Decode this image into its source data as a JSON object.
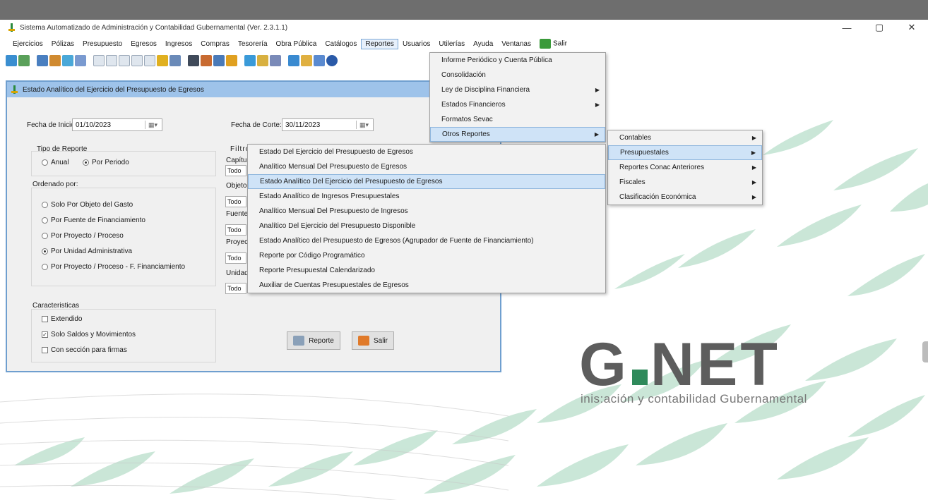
{
  "window": {
    "title": "Sistema Automatizado de Administración y Contabilidad Gubernamental (Ver. 2.3.1.1)",
    "controls": [
      "—",
      "▢",
      "✕"
    ]
  },
  "menubar": {
    "items": [
      "Ejercicios",
      "Pólizas",
      "Presupuesto",
      "Egresos",
      "Ingresos",
      "Compras",
      "Tesorería",
      "Obra Pública",
      "Catálogos",
      "Reportes",
      "Usuarios",
      "Utilerías",
      "Ayuda",
      "Ventanas"
    ],
    "active": "Reportes",
    "salir_label": "Salir"
  },
  "background": {
    "logo_text_left": "G",
    "logo_text_right": "NET",
    "logo_subtitle": "inis:ación y contabilidad Gubernamental",
    "accent": "#2f8a5b"
  },
  "dialog": {
    "title": "Estado Analítico del Ejercicio del Presupuesto de Egresos",
    "fecha_inicio_label": "Fecha de Inicio:",
    "fecha_inicio_value": "01/10/2023",
    "fecha_corte_label": "Fecha de Corte:",
    "fecha_corte_value": "30/11/2023",
    "tipo_reporte_label": "Tipo de Reporte",
    "tipo_anual": "Anual",
    "tipo_periodo": "Por Periodo",
    "filtros_label": "Filtros",
    "ordenado_label": "Ordenado por:",
    "ordenado_options": [
      "Solo Por Objeto del Gasto",
      "Por Fuente de Financiamiento",
      "Por Proyecto / Proceso",
      "Por Unidad Administrativa",
      "Por Proyecto / Proceso  -  F. Financiamiento"
    ],
    "ordenado_selected_index": 3,
    "caracteristicas_label": "Caracteristicas",
    "caracteristicas": [
      {
        "label": "Extendido",
        "checked": false
      },
      {
        "label": "Solo Saldos y Movimientos",
        "checked": true
      },
      {
        "label": "Con sección para firmas",
        "checked": false
      }
    ],
    "filter_fields": [
      {
        "label": "Capítu",
        "value": "Todo"
      },
      {
        "label": "Objeto",
        "value": "Todo"
      },
      {
        "label": "Fuente",
        "value": "Todo"
      },
      {
        "label": "Proyec",
        "value": "Todo"
      },
      {
        "label": "Unidad",
        "value": "Todo"
      }
    ],
    "reporte_button": "Reporte",
    "salir_button": "Salir"
  },
  "reportes_menu": {
    "items": [
      {
        "label": "Informe Periódico y Cuenta Pública",
        "submenu": false
      },
      {
        "label": "Consolidación",
        "submenu": false
      },
      {
        "label": "Ley de Disciplina Financiera",
        "submenu": true
      },
      {
        "label": "Estados Financieros",
        "submenu": true
      },
      {
        "label": "Formatos Sevac",
        "submenu": false
      },
      {
        "label": "Otros Reportes",
        "submenu": true
      }
    ],
    "selected_index": 5
  },
  "otros_menu": {
    "items": [
      {
        "label": "Contables",
        "submenu": true
      },
      {
        "label": "Presupuestales",
        "submenu": true
      },
      {
        "label": "Reportes Conac Anteriores",
        "submenu": true
      },
      {
        "label": "Fiscales",
        "submenu": true
      },
      {
        "label": "Clasificación Económica",
        "submenu": true
      }
    ],
    "selected_index": 1
  },
  "presupuestales_menu": {
    "items": [
      "Estado Del Ejercicio del Presupuesto de Egresos",
      "Analítico Mensual Del Presupuesto de Egresos",
      "Estado Analítico Del Ejercicio del Presupuesto de Egresos",
      "Estado Analítico de Ingresos Presupuestales",
      "Analítico Mensual Del Presupuesto de Ingresos",
      "Analítico Del Ejercicio del Presupuesto Disponible",
      "Estado Analítico del Presupuesto de Egresos (Agrupador de Fuente de Financiamiento)",
      "Reporte por Código Programático",
      "Reporte Presupuestal Calendarizado",
      "Auxiliar de Cuentas Presupuestales de Egresos"
    ],
    "selected_index": 2
  }
}
